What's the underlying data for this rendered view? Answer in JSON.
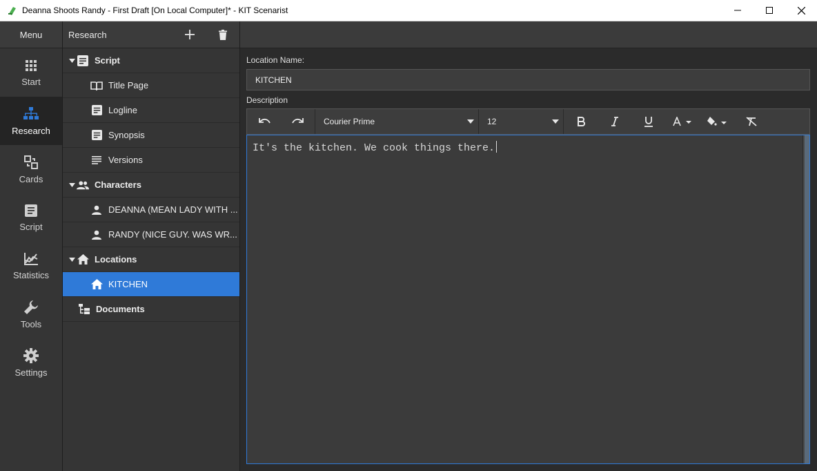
{
  "window": {
    "title": "Deanna Shoots Randy - First Draft [On Local Computer]* - KIT Scenarist"
  },
  "nav": {
    "menu_label": "Menu",
    "items": [
      {
        "label": "Start",
        "icon": "grid-icon"
      },
      {
        "label": "Research",
        "icon": "hierarchy-icon",
        "active": true
      },
      {
        "label": "Cards",
        "icon": "cards-icon"
      },
      {
        "label": "Script",
        "icon": "document-icon"
      },
      {
        "label": "Statistics",
        "icon": "chart-icon"
      },
      {
        "label": "Tools",
        "icon": "wrench-icon"
      },
      {
        "label": "Settings",
        "icon": "gear-icon"
      }
    ]
  },
  "tree": {
    "header": "Research",
    "items": [
      {
        "label": "Script"
      },
      {
        "label": "Title Page"
      },
      {
        "label": "Logline"
      },
      {
        "label": "Synopsis"
      },
      {
        "label": "Versions"
      },
      {
        "label": "Characters"
      },
      {
        "label": "DEANNA (MEAN LADY WITH ..."
      },
      {
        "label": "RANDY (NICE GUY. WAS WR..."
      },
      {
        "label": "Locations"
      },
      {
        "label": "KITCHEN",
        "selected": true
      },
      {
        "label": "Documents"
      }
    ]
  },
  "editor": {
    "location_name_label": "Location Name:",
    "location_name_value": "KITCHEN",
    "description_label": "Description",
    "font_family": "Courier Prime",
    "font_size": "12",
    "text": "It's the kitchen. We cook things there."
  },
  "colors": {
    "accent": "#2f7ad8",
    "panel": "#353535",
    "background": "#2b2b2b"
  }
}
